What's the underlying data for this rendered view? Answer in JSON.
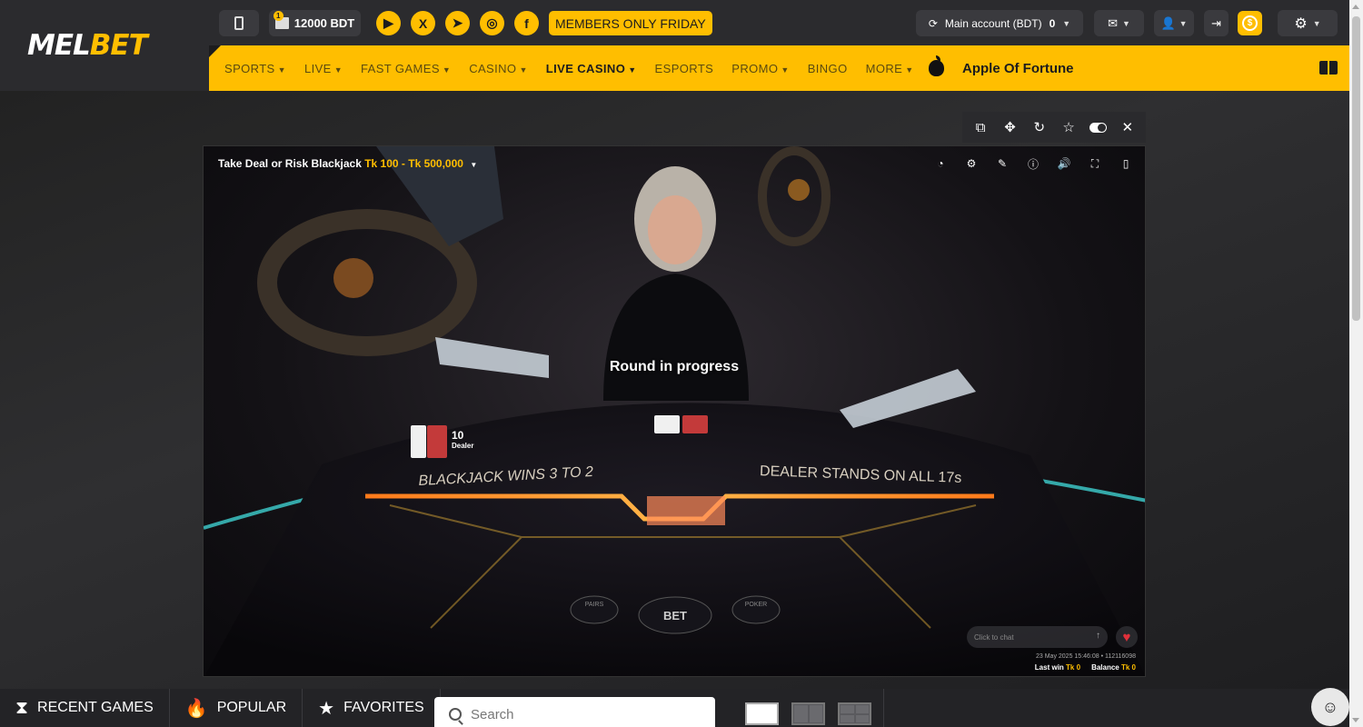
{
  "header": {
    "logo_mel": "MEL",
    "logo_bet": "BET",
    "bonus_count": "1",
    "bonus_amount": "12000 BDT",
    "socials": [
      {
        "name": "youtube-icon",
        "glyph": "▶"
      },
      {
        "name": "x-icon",
        "glyph": "X"
      },
      {
        "name": "telegram-icon",
        "glyph": "➤"
      },
      {
        "name": "instagram-icon",
        "glyph": "◎"
      },
      {
        "name": "facebook-icon",
        "glyph": "f"
      }
    ],
    "promo_label": "MEMBERS ONLY FRIDAY",
    "account_label": "Main account (BDT)",
    "account_balance": "0",
    "coin_symbol": "$"
  },
  "nav": {
    "items": [
      {
        "label": "SPORTS",
        "dropdown": true
      },
      {
        "label": "LIVE",
        "dropdown": true
      },
      {
        "label": "FAST GAMES",
        "dropdown": true
      },
      {
        "label": "CASINO",
        "dropdown": true
      },
      {
        "label": "LIVE CASINO",
        "dropdown": true,
        "active": true
      },
      {
        "label": "ESPORTS",
        "dropdown": false
      },
      {
        "label": "PROMO",
        "dropdown": true
      },
      {
        "label": "BINGO",
        "dropdown": false
      },
      {
        "label": "MORE",
        "dropdown": true
      }
    ],
    "featured_game": "Apple Of Fortune"
  },
  "game": {
    "table_name": "Take Deal or Risk Blackjack",
    "limits": "Tk 100 - Tk 500,000",
    "status": "Round in progress",
    "dealer_score": "10",
    "dealer_label": "Dealer",
    "table_left_text": "BLACKJACK WINS 3 TO 2",
    "table_right_text": "DEALER STANDS ON ALL 17s",
    "bet_label": "BET",
    "pairs_label": "PAIRS",
    "poker_label": "POKER",
    "chat_placeholder": "Click to chat",
    "timestamp": "23 May 2025 15:46:08 • 112116098",
    "last_win_label": "Last win",
    "last_win_value": "Tk 0",
    "balance_label": "Balance",
    "balance_value": "Tk 0"
  },
  "bottom": {
    "tabs": [
      {
        "name": "recent-games",
        "label": "RECENT GAMES",
        "glyph": "⧗"
      },
      {
        "name": "popular",
        "label": "POPULAR",
        "glyph": "🔥"
      },
      {
        "name": "favorites",
        "label": "FAVORITES",
        "glyph": "★"
      }
    ],
    "search_placeholder": "Search"
  },
  "colors": {
    "accent": "#ffbe00",
    "header_bg": "#2b2b2e",
    "page_bg": "#1c1c1e"
  }
}
